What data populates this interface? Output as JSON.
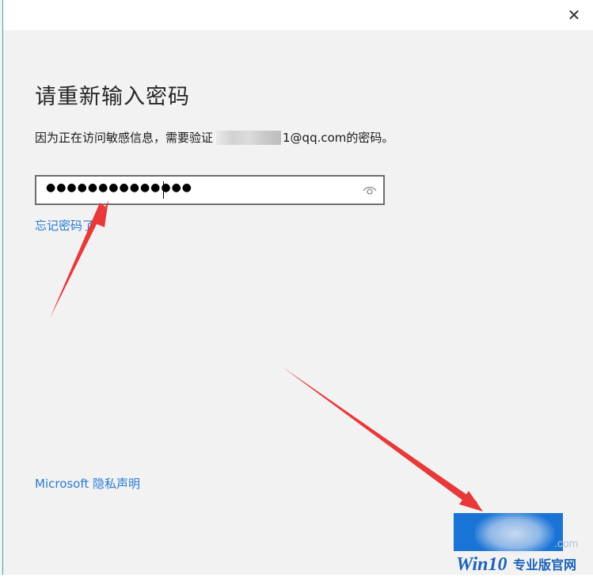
{
  "window": {
    "close_glyph": "✕"
  },
  "page": {
    "title": "请重新输入密码",
    "description_prefix": "因为正在访问敏感信息，需要验证",
    "description_email_suffix": "1@qq.com",
    "description_tail": " 的密码。"
  },
  "password_field": {
    "masked_value": "●●●●●●●●●●●●●●",
    "reveal_icon": "eye-icon"
  },
  "links": {
    "forgot_password": "忘记密码了",
    "privacy": "Microsoft 隐私声明"
  },
  "colors": {
    "link": "#2a7bd2",
    "button": "#1a74d6",
    "arrow": "#e8393a"
  },
  "watermark": {
    "brand": "Win10",
    "text": "专业版官网",
    "url_fragment": ".com"
  }
}
